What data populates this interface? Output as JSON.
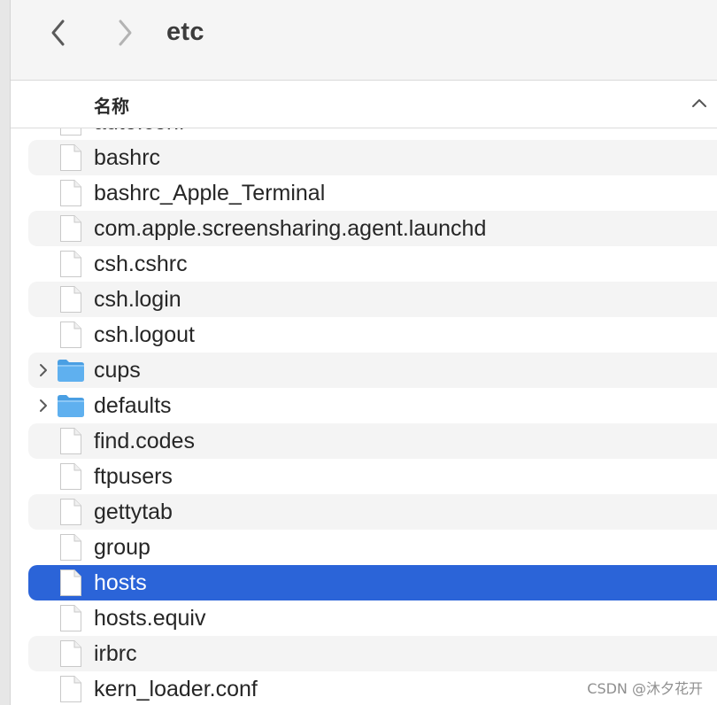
{
  "toolbar": {
    "title": "etc",
    "back_icon": "chevron-left-icon",
    "forward_icon": "chevron-right-icon"
  },
  "header": {
    "column_name": "名称",
    "sort_direction": "ascending",
    "sort_icon": "chevron-up-icon"
  },
  "files": [
    {
      "name": "auto.conf",
      "type": "file",
      "partially_visible": true
    },
    {
      "name": "bashrc",
      "type": "file"
    },
    {
      "name": "bashrc_Apple_Terminal",
      "type": "file"
    },
    {
      "name": "com.apple.screensharing.agent.launchd",
      "type": "file"
    },
    {
      "name": "csh.cshrc",
      "type": "file"
    },
    {
      "name": "csh.login",
      "type": "file"
    },
    {
      "name": "csh.logout",
      "type": "file"
    },
    {
      "name": "cups",
      "type": "folder"
    },
    {
      "name": "defaults",
      "type": "folder"
    },
    {
      "name": "find.codes",
      "type": "file"
    },
    {
      "name": "ftpusers",
      "type": "file"
    },
    {
      "name": "gettytab",
      "type": "file"
    },
    {
      "name": "group",
      "type": "file"
    },
    {
      "name": "hosts",
      "type": "file",
      "selected": true
    },
    {
      "name": "hosts.equiv",
      "type": "file"
    },
    {
      "name": "irbrc",
      "type": "file"
    },
    {
      "name": "kern_loader.conf",
      "type": "file"
    }
  ],
  "colors": {
    "selection": "#2b64d8",
    "alternate_row": "#f4f4f4",
    "folder_blue": "#5fb0ef"
  },
  "watermark": "CSDN @沐夕花开"
}
